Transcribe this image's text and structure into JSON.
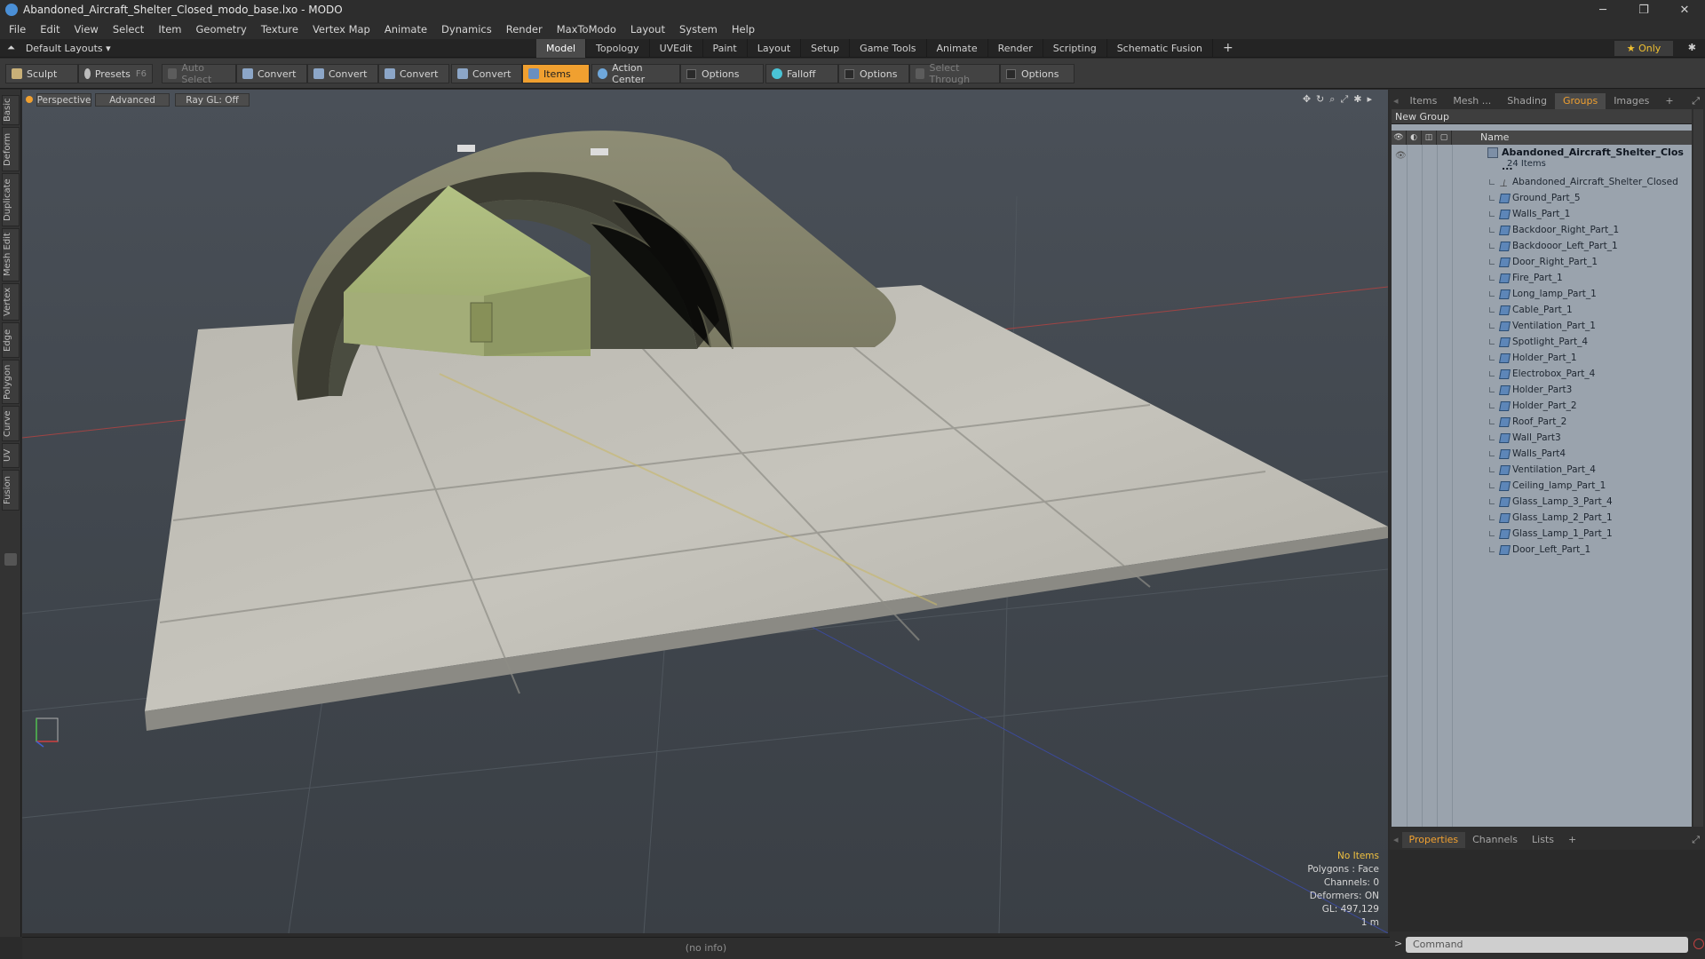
{
  "window": {
    "title": "Abandoned_Aircraft_Shelter_Closed_modo_base.lxo - MODO",
    "controls": [
      "─",
      "❐",
      "✕"
    ]
  },
  "menu": [
    "File",
    "Edit",
    "View",
    "Select",
    "Item",
    "Geometry",
    "Texture",
    "Vertex Map",
    "Animate",
    "Dynamics",
    "Render",
    "MaxToModo",
    "Layout",
    "System",
    "Help"
  ],
  "layout_bar": {
    "layout_selector": "Default Layouts ▾",
    "tabs": [
      "Model",
      "Topology",
      "UVEdit",
      "Paint",
      "Layout",
      "Setup",
      "Game Tools",
      "Animate",
      "Render",
      "Scripting",
      "Schematic Fusion"
    ],
    "active_tab": "Model",
    "add": "+",
    "only": "★  Only",
    "gear": "✱"
  },
  "toolbar": {
    "sculpt": "Sculpt",
    "presets": "Presets",
    "presets_key": "F6",
    "auto_select": "Auto Select",
    "convert1": "Convert",
    "convert2": "Convert",
    "convert3": "Convert",
    "convert4": "Convert",
    "items": "Items",
    "action_center": "Action Center",
    "options1": "Options",
    "falloff": "Falloff",
    "options2": "Options",
    "select_through": "Select Through",
    "options3": "Options"
  },
  "left_strip": [
    "Basic",
    "Deform",
    "Duplicate",
    "Mesh Edit",
    "Vertex",
    "Edge",
    "Polygon",
    "Curve",
    "UV",
    "Fusion"
  ],
  "viewport": {
    "view": "Perspective",
    "mode": "Advanced",
    "raygl": "Ray GL: Off",
    "info": {
      "selection": "No Items",
      "polygons": "Polygons : Face",
      "channels": "Channels: 0",
      "deformers": "Deformers: ON",
      "gl": "GL: 497,129",
      "scale": "1 m"
    }
  },
  "status": "(no info)",
  "right_panel": {
    "tabs": [
      "Items",
      "Mesh ...",
      "Shading",
      "Groups",
      "Images",
      "+"
    ],
    "active_tab": "Groups",
    "new_group": "New Group",
    "name_header": "Name",
    "group_name": "Abandoned_Aircraft_Shelter_Clos ...",
    "group_count": "24 Items",
    "items": [
      "Abandoned_Aircraft_Shelter_Closed",
      "Ground_Part_5",
      "Walls_Part_1",
      "Backdoor_Right_Part_1",
      "Backdooor_Left_Part_1",
      "Door_Right_Part_1",
      "Fire_Part_1",
      "Long_lamp_Part_1",
      "Cable_Part_1",
      "Ventilation_Part_1",
      "Spotlight_Part_4",
      "Holder_Part_1",
      "Electrobox_Part_4",
      "Holder_Part3",
      "Holder_Part_2",
      "Roof_Part_2",
      "Wall_Part3",
      "Walls_Part4",
      "Ventilation_Part_4",
      "Ceiling_lamp_Part_1",
      "Glass_Lamp_3_Part_4",
      "Glass_Lamp_2_Part_1",
      "Glass_Lamp_1_Part_1",
      "Door_Left_Part_1"
    ],
    "props_tabs": [
      "Properties",
      "Channels",
      "Lists",
      "+"
    ],
    "props_active": "Properties",
    "command_placeholder": "Command"
  },
  "colors": {
    "accent": "#f0a030",
    "viewport_bg": "#444a51",
    "list_bg": "#9aa3ad"
  }
}
